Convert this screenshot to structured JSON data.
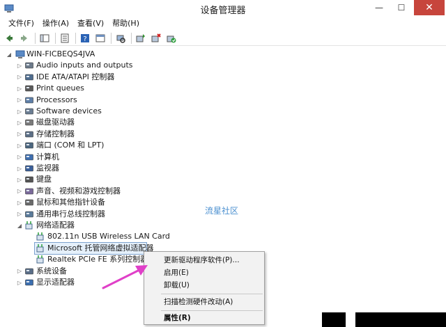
{
  "window": {
    "title": "设备管理器",
    "controls": {
      "min": "—",
      "max": "☐",
      "close": "✕"
    }
  },
  "menu": [
    "文件(F)",
    "操作(A)",
    "查看(V)",
    "帮助(H)"
  ],
  "tree": {
    "root": "WIN-FICBEQS4JVA",
    "nodes": [
      "Audio inputs and outputs",
      "IDE ATA/ATAPI 控制器",
      "Print queues",
      "Processors",
      "Software devices",
      "磁盘驱动器",
      "存储控制器",
      "端口 (COM 和 LPT)",
      "计算机",
      "监视器",
      "键盘",
      "声音、视频和游戏控制器",
      "鼠标和其他指针设备",
      "通用串行总线控制器",
      "网络适配器",
      "802.11n USB Wireless LAN Card",
      "Microsoft 托管网络虚拟适配器",
      "Realtek PCIe FE 系列控制器",
      "系统设备",
      "显示适配器"
    ]
  },
  "watermark": "流星社区",
  "context_menu": [
    "更新驱动程序软件(P)...",
    "启用(E)",
    "卸载(U)",
    "扫描检测硬件改动(A)",
    "属性(R)"
  ],
  "colors": {
    "close_button": "#c7453c",
    "selection": "#e5f0fb",
    "annotation_arrow": "#e040c8"
  }
}
